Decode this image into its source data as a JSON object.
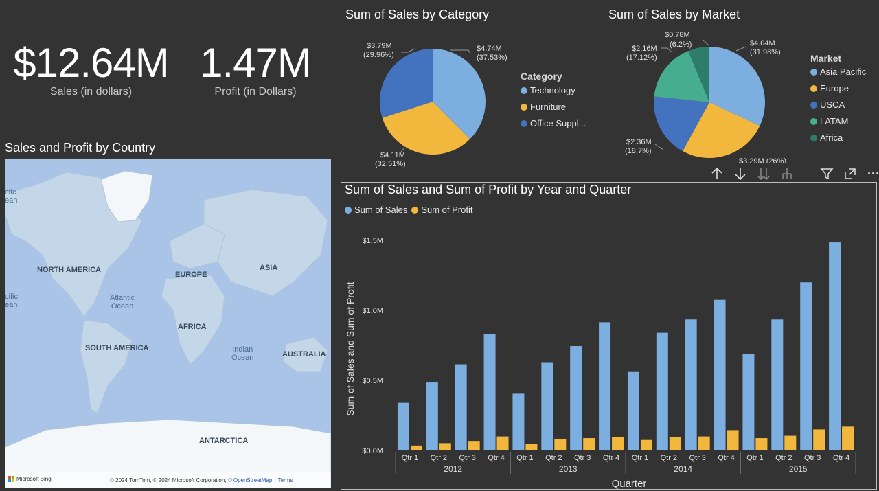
{
  "kpis": [
    {
      "value": "$12.64M",
      "label": "Sales (in dollars)"
    },
    {
      "value": "1.47M",
      "label": "Profit (in Dollars)"
    }
  ],
  "category_pie": {
    "title": "Sum of Sales by Category",
    "legend_title": "Category",
    "items": [
      {
        "label": "Technology",
        "value_label": "$4.74M",
        "pct_label": "(37.53%)",
        "pct": 37.53,
        "color": "#7caedf"
      },
      {
        "label": "Furniture",
        "value_label": "$4.11M",
        "pct_label": "(32.51%)",
        "pct": 32.51,
        "color": "#f2b73d"
      },
      {
        "label": "Office Suppl...",
        "value_label": "$3.79M",
        "pct_label": "(29.96%)",
        "pct": 29.96,
        "color": "#4372be"
      }
    ]
  },
  "market_pie": {
    "title": "Sum of Sales by Market",
    "legend_title": "Market",
    "items": [
      {
        "label": "Asia Pacific",
        "value_label": "$4.04M",
        "pct_label": "(31.98%)",
        "pct": 31.98,
        "color": "#7caedf"
      },
      {
        "label": "Europe",
        "value_label": "$3.29M",
        "pct_label": "(26%)",
        "pct": 26.0,
        "color": "#f2b73d"
      },
      {
        "label": "USCA",
        "value_label": "$2.36M",
        "pct_label": "(18.7%)",
        "pct": 18.7,
        "color": "#4372be"
      },
      {
        "label": "LATAM",
        "value_label": "$2.16M",
        "pct_label": "(17.12%)",
        "pct": 17.12,
        "color": "#47ad8f"
      },
      {
        "label": "Africa",
        "value_label": "$0.78M",
        "pct_label": "(6.2%)",
        "pct": 6.2,
        "color": "#2e7d6a"
      }
    ],
    "clipped_label": "$3.29M (26%)"
  },
  "map": {
    "title": "Sales and Profit by Country",
    "labels": {
      "north_america": "NORTH AMERICA",
      "south_america": "SOUTH AMERICA",
      "europe": "EUROPE",
      "africa": "AFRICA",
      "asia": "ASIA",
      "australia": "AUSTRALIA",
      "antarctica": "ANTARCTICA"
    },
    "oceans": {
      "atlantic_1": "Atlantic",
      "atlantic_2": "Ocean",
      "indian_1": "Indian",
      "indian_2": "Ocean",
      "pacific_n_1": "ctic",
      "pacific_n_2": "ean",
      "pacific_s_1": "cific",
      "pacific_s_2": "ean"
    },
    "bing": "Microsoft Bing",
    "copyright": "© 2024 TomTom, © 2024 Microsoft Corporation,",
    "osm_link": "© OpenStreetMap",
    "terms_link": "Terms"
  },
  "toolbar": {
    "icons": [
      "arrow-up-icon",
      "arrow-down-icon",
      "double-arrow-down-icon",
      "expand-hierarchy-icon",
      "filter-icon",
      "focus-mode-icon",
      "more-options-icon"
    ],
    "more": "···"
  },
  "chart_data": {
    "type": "bar",
    "title": "Sum of Sales and Sum of Profit by Year and Quarter",
    "xlabel": "Quarter",
    "ylabel": "Sum of Sales and Sum of Profit",
    "categories": [
      "Qtr 1",
      "Qtr 2",
      "Qtr 3",
      "Qtr 4",
      "Qtr 1",
      "Qtr 2",
      "Qtr 3",
      "Qtr 4",
      "Qtr 1",
      "Qtr 2",
      "Qtr 3",
      "Qtr 4",
      "Qtr 1",
      "Qtr 2",
      "Qtr 3",
      "Qtr 4"
    ],
    "years": [
      "2012",
      "2013",
      "2014",
      "2015"
    ],
    "series": [
      {
        "name": "Sum of Sales",
        "color": "#7caedf",
        "values": [
          340000,
          485000,
          615000,
          830000,
          405000,
          630000,
          745000,
          915000,
          565000,
          840000,
          935000,
          1075000,
          690000,
          935000,
          1200000,
          1485000
        ]
      },
      {
        "name": "Sum of Profit",
        "color": "#f2b73d",
        "values": [
          35000,
          52000,
          68000,
          100000,
          45000,
          83000,
          88000,
          97000,
          75000,
          95000,
          100000,
          145000,
          88000,
          105000,
          150000,
          170000
        ]
      }
    ],
    "ylim": [
      0,
      1500000
    ],
    "yticks": [
      "$0.0M",
      "$0.5M",
      "$1.0M",
      "$1.5M"
    ],
    "ytick_values": [
      0,
      500000,
      1000000,
      1500000
    ],
    "legend_position": "top-left",
    "grid": false
  }
}
